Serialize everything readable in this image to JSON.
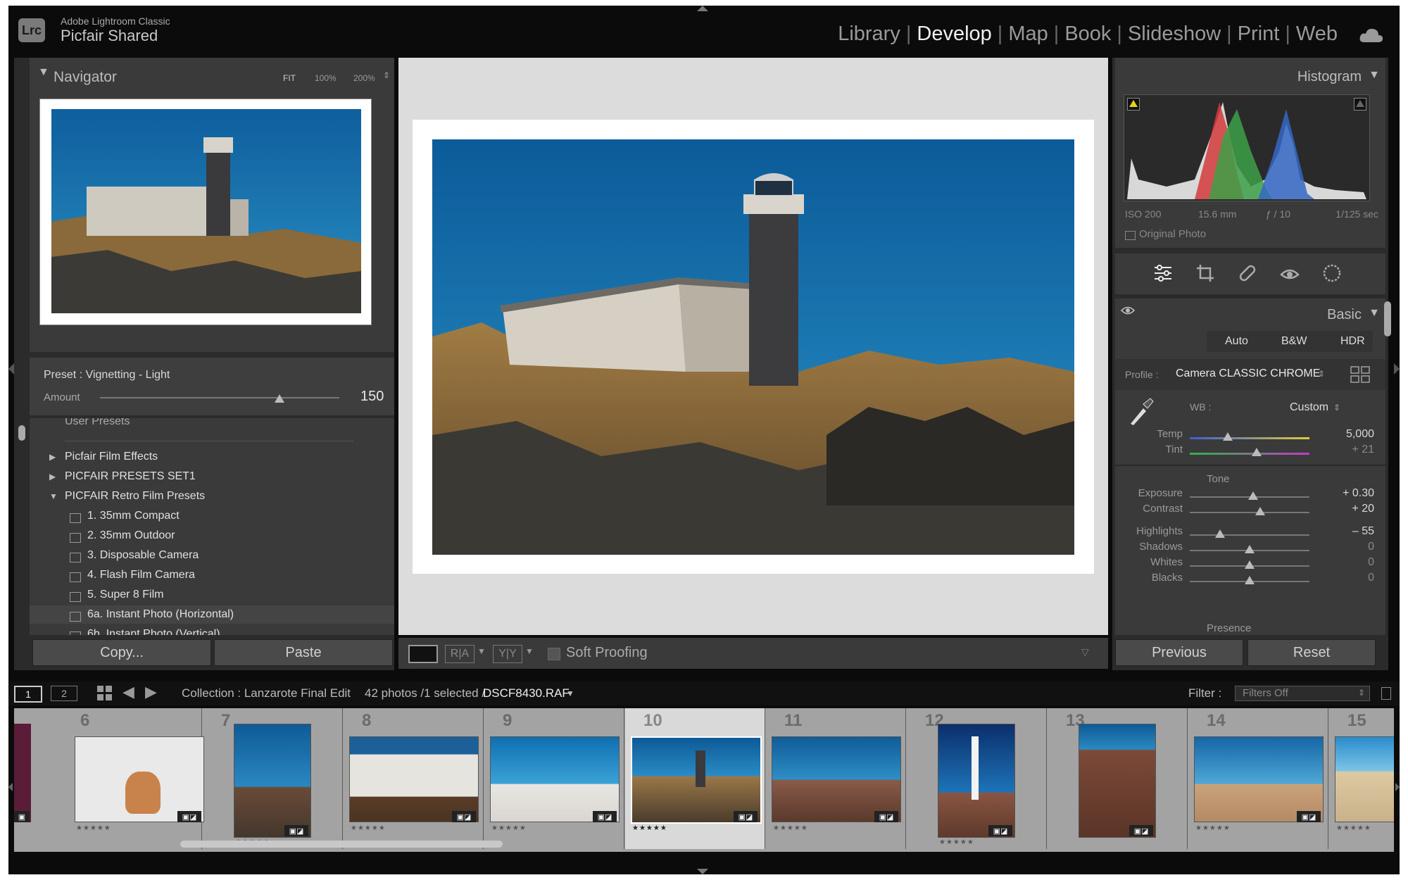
{
  "app": {
    "badge": "Lrc",
    "product": "Adobe Lightroom Classic",
    "catalog": "Picfair Shared"
  },
  "modules": [
    {
      "label": "Library"
    },
    {
      "label": "Develop"
    },
    {
      "label": "Map"
    },
    {
      "label": "Book"
    },
    {
      "label": "Slideshow"
    },
    {
      "label": "Print"
    },
    {
      "label": "Web"
    }
  ],
  "active_module": "Develop",
  "navigator": {
    "title": "Navigator",
    "fit": "FIT",
    "z100": "100%",
    "z200": "200%"
  },
  "preset_info": {
    "preset": "Preset : Vignetting - Light",
    "amount_label": "Amount",
    "amount_value": "150",
    "amount_fraction": 0.75
  },
  "presets": {
    "partial_top": "User Presets",
    "groups": [
      {
        "label": "Picfair Film Effects"
      },
      {
        "label": "PICFAIR PRESETS SET1"
      },
      {
        "label": "PICFAIR Retro Film Presets"
      }
    ],
    "items": [
      {
        "label": "1. 35mm Compact"
      },
      {
        "label": "2. 35mm Outdoor"
      },
      {
        "label": "3. Disposable Camera"
      },
      {
        "label": "4. Flash Film Camera"
      },
      {
        "label": "5. Super 8 Film"
      },
      {
        "label": "6a. Instant Photo (Horizontal)"
      },
      {
        "label": "6b. Instant Photo (Vertical)"
      }
    ]
  },
  "left_buttons": {
    "copy": "Copy...",
    "paste": "Paste"
  },
  "toolbar": {
    "soft_proofing": "Soft Proofing"
  },
  "histogram": {
    "title": "Histogram",
    "iso": "ISO 200",
    "focal": "15.6 mm",
    "aperture": "ƒ / 10",
    "shutter": "1/125 sec",
    "original_photo": "Original Photo"
  },
  "basic": {
    "title": "Basic",
    "auto": "Auto",
    "bw": "B&W",
    "hdr": "HDR",
    "profile_label": "Profile :",
    "profile_value": "Camera CLASSIC CHROME",
    "wb_label": "WB :",
    "wb_value": "Custom",
    "tone_label": "Tone",
    "presence_label": "Presence",
    "sliders": [
      {
        "key": "temp",
        "label": "Temp",
        "value": "5,000",
        "pos": 0.32
      },
      {
        "key": "tint",
        "label": "Tint",
        "value": "+ 21",
        "pos": 0.56
      },
      {
        "key": "exposure",
        "label": "Exposure",
        "value": "+ 0.30",
        "pos": 0.53
      },
      {
        "key": "contrast",
        "label": "Contrast",
        "value": "+ 20",
        "pos": 0.59
      },
      {
        "key": "highlights",
        "label": "Highlights",
        "value": "– 55",
        "pos": 0.25
      },
      {
        "key": "shadows",
        "label": "Shadows",
        "value": "0",
        "pos": 0.5
      },
      {
        "key": "whites",
        "label": "Whites",
        "value": "0",
        "pos": 0.5
      },
      {
        "key": "blacks",
        "label": "Blacks",
        "value": "0",
        "pos": 0.5
      }
    ]
  },
  "right_buttons": {
    "previous": "Previous",
    "reset": "Reset"
  },
  "filmstrip_bar": {
    "view1": "1",
    "view2": "2",
    "collection": "Collection : Lanzarote Final Edit",
    "count": "42 photos /1 selected /",
    "filename": "DSCF8430.RAF",
    "filter_label": "Filter :",
    "filter_value": "Filters Off"
  },
  "filmstrip": [
    {
      "num": "6",
      "stars": "★★★★★"
    },
    {
      "num": "7",
      "stars": "★★★★★"
    },
    {
      "num": "8",
      "stars": "★★★★★"
    },
    {
      "num": "9",
      "stars": "★★★★★"
    },
    {
      "num": "10",
      "stars": "★★★★★"
    },
    {
      "num": "11",
      "stars": "★★★★★"
    },
    {
      "num": "12",
      "stars": "★★★★★"
    },
    {
      "num": "13",
      "stars": "★★★★★"
    },
    {
      "num": "14",
      "stars": "★★★★★"
    },
    {
      "num": "15",
      "stars": "★★★★★"
    }
  ],
  "colors": {
    "accent": "#ffffff",
    "panel": "#363636",
    "bg": "#0b0b0b"
  }
}
